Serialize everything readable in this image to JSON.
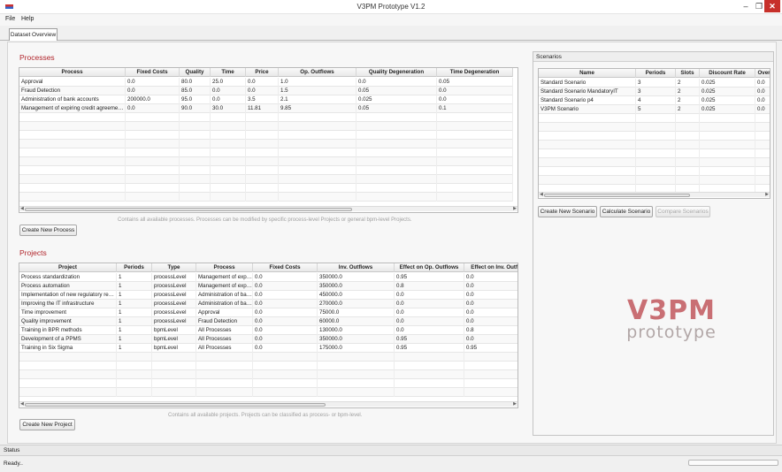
{
  "window": {
    "title": "V3PM Prototype V1.2",
    "min_glyph": "–",
    "max_glyph": "❐",
    "close_glyph": "✕"
  },
  "menu": [
    "File",
    "Help"
  ],
  "tabs": [
    {
      "label": "Dataset Overview",
      "selected": true
    }
  ],
  "processes": {
    "title": "Processes",
    "columns": [
      "Process",
      "Fixed Costs",
      "Quality",
      "Time",
      "Price",
      "Op. Outflows",
      "Quality Degeneration",
      "Time Degeneration"
    ],
    "rows": [
      [
        "Approval",
        "0.0",
        "80.0",
        "25.0",
        "0.0",
        "1.0",
        "0.0",
        "0.05"
      ],
      [
        "Fraud Detection",
        "0.0",
        "85.0",
        "0.0",
        "0.0",
        "1.5",
        "0.05",
        "0.0"
      ],
      [
        "Administration of bank accounts",
        "200000.0",
        "95.0",
        "0.0",
        "3.5",
        "2.1",
        "0.025",
        "0.0"
      ],
      [
        "Management of expiring credit agreements",
        "0.0",
        "90.0",
        "30.0",
        "11.81",
        "9.85",
        "0.05",
        "0.1"
      ]
    ],
    "hint": "Contains all available processes. Processes can be modified by specific process-level Projects or general bpm-level Projects.",
    "create_button": "Create New Process"
  },
  "projects": {
    "title": "Projects",
    "columns": [
      "Project",
      "Periods",
      "Type",
      "Process",
      "Fixed Costs",
      "Inv. Outflows",
      "Effect on Op. Outflows",
      "Effect on Inv. Outfl"
    ],
    "rows": [
      [
        "Process standardization",
        "1",
        "processLevel",
        "Management of expiring credit agreements",
        "0.0",
        "350000.0",
        "0.95",
        "0.0"
      ],
      [
        "Process automation",
        "1",
        "processLevel",
        "Management of expiring credit agreements",
        "0.0",
        "350000.0",
        "0.8",
        "0.0"
      ],
      [
        "Implementation of new regulatory requirements",
        "1",
        "processLevel",
        "Administration of bank accounts",
        "0.0",
        "450000.0",
        "0.0",
        "0.0"
      ],
      [
        "Improving the IT infrastructure",
        "1",
        "processLevel",
        "Administration of bank accounts",
        "0.0",
        "270000.0",
        "0.0",
        "0.0"
      ],
      [
        "Time improvement",
        "1",
        "processLevel",
        "Approval",
        "0.0",
        "75000.0",
        "0.0",
        "0.0"
      ],
      [
        "Quality improvement",
        "1",
        "processLevel",
        "Fraud Detection",
        "0.0",
        "60000.0",
        "0.0",
        "0.0"
      ],
      [
        "Training in BPR methods",
        "1",
        "bpmLevel",
        "All Processes",
        "0.0",
        "130000.0",
        "0.0",
        "0.8"
      ],
      [
        "Development of a PPMS",
        "1",
        "bpmLevel",
        "All Processes",
        "0.0",
        "350000.0",
        "0.95",
        "0.0"
      ],
      [
        "Training in Six Sigma",
        "1",
        "bpmLevel",
        "All Processes",
        "0.0",
        "175000.0",
        "0.95",
        "0.95"
      ]
    ],
    "hint": "Contains all available projects. Projects can be classified as process- or bpm-level.",
    "create_button": "Create New Project"
  },
  "scenarios": {
    "panel_title": "Scenarios",
    "columns": [
      "Name",
      "Periods",
      "Slots",
      "Discount Rate",
      "Over"
    ],
    "rows": [
      [
        "Standard Scenario",
        "3",
        "2",
        "0.025",
        "0.0"
      ],
      [
        "Standard Scenario MandatoryIT",
        "3",
        "2",
        "0.025",
        "0.0"
      ],
      [
        "Standard Scenario p4",
        "4",
        "2",
        "0.025",
        "0.0"
      ],
      [
        "V3PM Scenario",
        "5",
        "2",
        "0.025",
        "0.0"
      ]
    ],
    "buttons": {
      "create": "Create New Scenario",
      "calculate": "Calculate Scenario",
      "compare": "Compare Scenarios"
    }
  },
  "logo": {
    "big": "V3PM",
    "small": "prototype",
    "color": "#c96f74"
  },
  "status": {
    "title": "Status",
    "text": "Ready..",
    "progress": 0
  }
}
